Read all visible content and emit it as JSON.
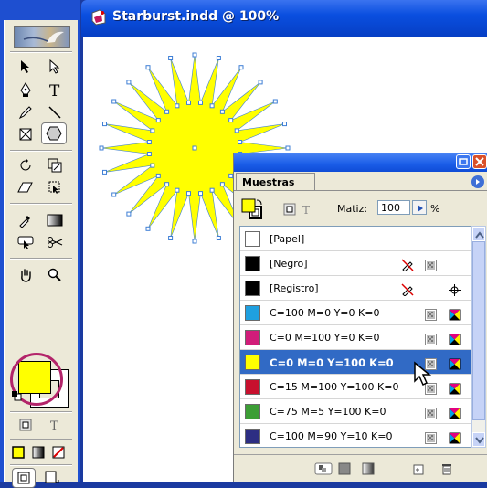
{
  "document": {
    "title": "Starburst.indd @ 100%"
  },
  "panel": {
    "tab_label": "Muestras",
    "tint_label": "Matiz:",
    "tint_value": "100",
    "tint_unit": "%",
    "swatches": [
      {
        "name": "[Papel]",
        "color": "#ffffff"
      },
      {
        "name": "[Negro]",
        "color": "#000000"
      },
      {
        "name": "[Registro]",
        "color": "#000000"
      },
      {
        "name": "C=100 M=0 Y=0 K=0",
        "color": "#1fa0e0"
      },
      {
        "name": "C=0 M=100 Y=0 K=0",
        "color": "#d11d7a"
      },
      {
        "name": "C=0 M=0 Y=100 K=0",
        "color": "#ffff00"
      },
      {
        "name": "C=15 M=100 Y=100 K=0",
        "color": "#c8102e"
      },
      {
        "name": "C=75 M=5 Y=100 K=0",
        "color": "#3c9e35"
      },
      {
        "name": "C=100 M=90 Y=10 K=0",
        "color": "#2d2e83"
      }
    ],
    "selected_index": 5
  },
  "toolbox": {
    "fill_color": "#ffff00",
    "stroke_color": "#ffffff"
  },
  "colors": {
    "title_bar": "#0a4fe0",
    "selection": "#316ac5",
    "highlight_ring": "#b3246a",
    "starburst_fill": "#ffff00",
    "anchor_points": "#3f7fd6"
  }
}
